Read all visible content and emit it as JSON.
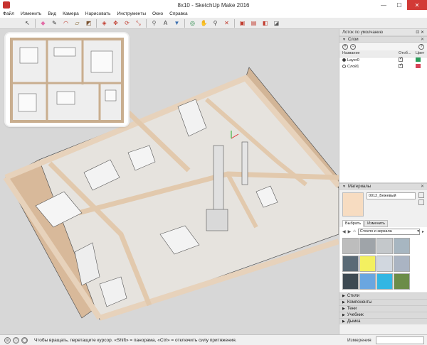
{
  "window": {
    "title": "8x10 - SketchUp Make 2016",
    "minimize": "—",
    "maximize": "☐",
    "close": "✕"
  },
  "menu": [
    "Файл",
    "Изменить",
    "Вид",
    "Камера",
    "Нарисовать",
    "Инструменты",
    "Окно",
    "Справка"
  ],
  "toolbar": [
    {
      "icon": "select-arrow-icon",
      "glyph": "↖",
      "color": "#333333"
    },
    {
      "icon": "eraser-icon",
      "glyph": "◆",
      "color": "#e26ea8"
    },
    {
      "icon": "line-pencil-icon",
      "glyph": "✎",
      "color": "#333333"
    },
    {
      "icon": "arc-icon",
      "glyph": "◠",
      "color": "#c0392b"
    },
    {
      "icon": "shape-icon",
      "glyph": "▱",
      "color": "#8a6d3b"
    },
    {
      "icon": "push-pull-icon",
      "glyph": "◩",
      "color": "#7a5230"
    },
    {
      "icon": "offset-icon",
      "glyph": "◈",
      "color": "#c0392b"
    },
    {
      "icon": "move-icon",
      "glyph": "✥",
      "color": "#c0392b"
    },
    {
      "icon": "rotate-icon",
      "glyph": "⟳",
      "color": "#c0392b"
    },
    {
      "icon": "scale-icon",
      "glyph": "⤡",
      "color": "#c0392b"
    },
    {
      "icon": "tape-measure-icon",
      "glyph": "⚲",
      "color": "#555555"
    },
    {
      "icon": "text-icon",
      "glyph": "A",
      "color": "#2b2b2b"
    },
    {
      "icon": "paint-bucket-icon",
      "glyph": "▼",
      "color": "#3a6fb0"
    },
    {
      "icon": "orbit-icon",
      "glyph": "◎",
      "color": "#2a8a4a"
    },
    {
      "icon": "pan-icon",
      "glyph": "✋",
      "color": "#444444"
    },
    {
      "icon": "zoom-icon",
      "glyph": "⚲",
      "color": "#444444"
    },
    {
      "icon": "zoom-extents-icon",
      "glyph": "✕",
      "color": "#c0392b"
    },
    {
      "icon": "warehouse-icon",
      "glyph": "▣",
      "color": "#c0392b"
    },
    {
      "icon": "components-icon",
      "glyph": "▤",
      "color": "#c0392b"
    },
    {
      "icon": "extension-icon",
      "glyph": "◧",
      "color": "#c0392b"
    },
    {
      "icon": "layout-icon",
      "glyph": "◪",
      "color": "#555555"
    }
  ],
  "tray": {
    "title": "Лоток по умолчанию",
    "pin": "⊡ ✕"
  },
  "layers": {
    "title": "Слои",
    "close": "✕",
    "columns": [
      "Название",
      "Отоб...",
      "Цвет"
    ],
    "rows": [
      {
        "name": "Layer0",
        "active": true,
        "color": "#2a9d5b"
      },
      {
        "name": "Слой1",
        "active": false,
        "color": "#d64559"
      }
    ],
    "add": "+",
    "remove": "−",
    "help": "?"
  },
  "materials": {
    "title": "Материалы",
    "close": "✕",
    "name": "0012_Бежевый",
    "tabs": [
      "Выбрать",
      "Изменить"
    ],
    "category": "Стекло и зеркала",
    "swatches": [
      "#bdbdbd",
      "#9fa4a9",
      "#c4c8cb",
      "#a7b6c1",
      "#5a6a76",
      "#f3f060",
      "#d1d7df",
      "#aab4c3",
      "#3e4a52",
      "#6aa6e0",
      "#33b6e3",
      "#6b8c48"
    ]
  },
  "collapsed_panels": [
    "Стили",
    "Компоненты",
    "Тени",
    "Учебник",
    "Дымка"
  ],
  "status": {
    "message": "Чтобы вращать, перетащите курсор. «Shift» = панорама, «Ctrl» = отключить силу притяжения.",
    "measure_label": "Измерения"
  }
}
